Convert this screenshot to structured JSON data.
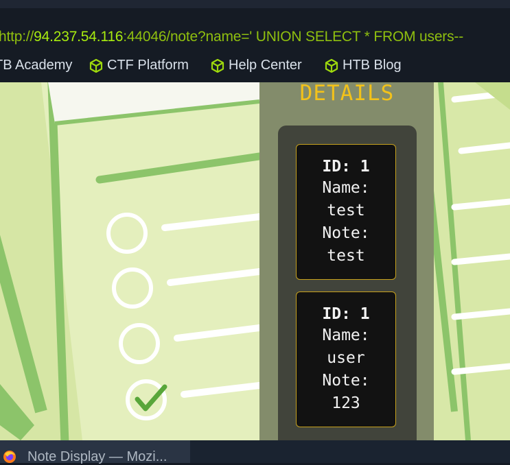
{
  "browser": {
    "url": {
      "prefix": "http://",
      "host": "94.237.54.116",
      "rest": ":44046/note?name=' UNION SELECT * FROM users--"
    },
    "bookmarks": [
      {
        "label": "TB Academy",
        "icon": "none"
      },
      {
        "label": "CTF Platform",
        "icon": "cube-icon"
      },
      {
        "label": "Help Center",
        "icon": "cube-icon"
      },
      {
        "label": "HTB Blog",
        "icon": "cube-icon"
      }
    ]
  },
  "page": {
    "panel_title": "DETAILS",
    "records": [
      {
        "id": "ID: 1",
        "name_label": "Name:",
        "name": "test",
        "note_label": "Note:",
        "note": "test"
      },
      {
        "id": "ID: 1",
        "name_label": "Name:",
        "name": "user",
        "note_label": "Note:",
        "note": "123"
      }
    ]
  },
  "taskbar": {
    "window_title": "Note Display — Mozi..."
  },
  "colors": {
    "accent_green": "#9ed90d",
    "gold": "#f3c21a",
    "card_border": "#c8a21d"
  }
}
